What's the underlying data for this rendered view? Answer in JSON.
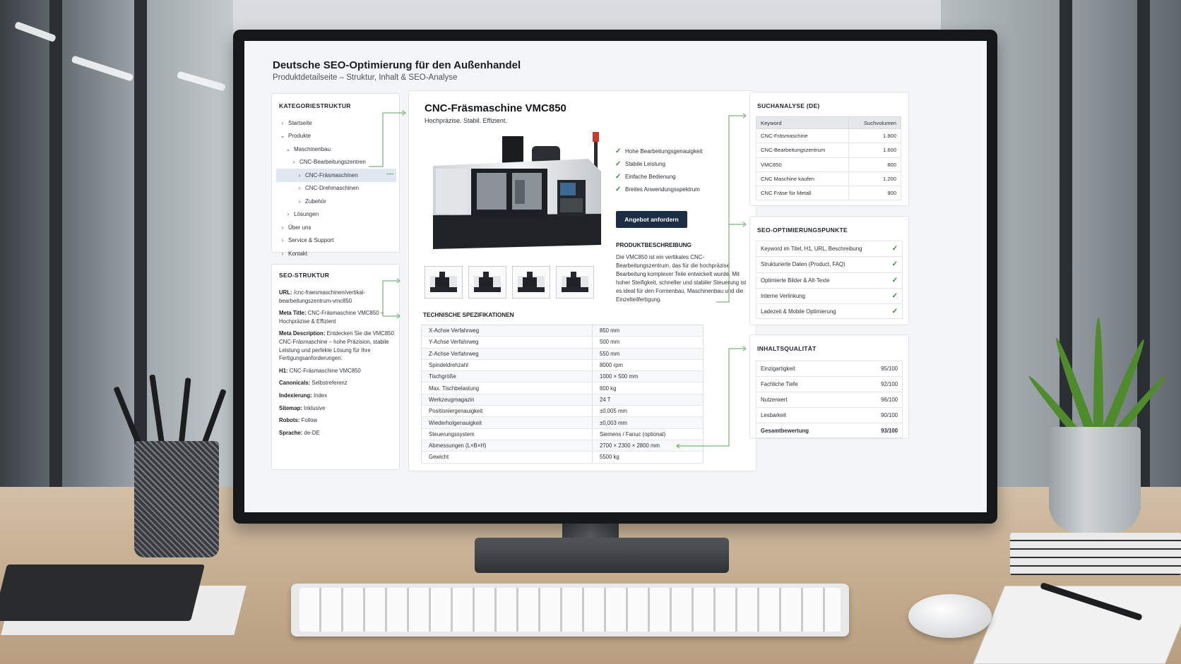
{
  "page": {
    "title": "Deutsche SEO-Optimierung für den Außenhandel",
    "subtitle": "Produktdetailseite – Struktur, Inhalt & SEO-Analyse"
  },
  "categories": {
    "heading": "KATEGORIESTRUKTUR",
    "items": [
      {
        "label": "Startseite",
        "depth": 0,
        "chevron": "›",
        "selected": false
      },
      {
        "label": "Produkte",
        "depth": 0,
        "chevron": "⌄",
        "selected": false
      },
      {
        "label": "Maschinenbau",
        "depth": 1,
        "chevron": "⌄",
        "selected": false
      },
      {
        "label": "CNC-Bearbeitungszentren",
        "depth": 2,
        "chevron": "›",
        "selected": false
      },
      {
        "label": "CNC-Fräsmaschinen",
        "depth": 3,
        "chevron": "›",
        "selected": true
      },
      {
        "label": "CNC-Drehmaschinen",
        "depth": 3,
        "chevron": "›",
        "selected": false
      },
      {
        "label": "Zubehör",
        "depth": 3,
        "chevron": "›",
        "selected": false
      },
      {
        "label": "Lösungen",
        "depth": 1,
        "chevron": "›",
        "selected": false
      },
      {
        "label": "Über uns",
        "depth": 0,
        "chevron": "›",
        "selected": false
      },
      {
        "label": "Service & Support",
        "depth": 0,
        "chevron": "›",
        "selected": false
      },
      {
        "label": "Kontakt",
        "depth": 0,
        "chevron": "›",
        "selected": false
      }
    ]
  },
  "seo_structure": {
    "heading": "SEO-STRUKTUR",
    "items": [
      {
        "key": "URL:",
        "value": "/cnc-fraesmaschinen/vertikal-bearbeitungszentrum-vmc850"
      },
      {
        "key": "Meta Title:",
        "value": "CNC-Fräsmaschine VMC850 – Hochpräzise & Effizient"
      },
      {
        "key": "Meta Description:",
        "value": "Entdecken Sie die VMC850 CNC-Fräsmaschine – hohe Präzision, stabile Leistung und perfekte Lösung für Ihre Fertigungsanforderungen."
      },
      {
        "key": "H1:",
        "value": "CNC-Fräsmaschine VMC850"
      },
      {
        "key": "Canonicals:",
        "value": "Selbstreferenz"
      },
      {
        "key": "Indexierung:",
        "value": "Index"
      },
      {
        "key": "Sitemap:",
        "value": "Inklusive"
      },
      {
        "key": "Robots:",
        "value": "Follow"
      },
      {
        "key": "Sprache:",
        "value": "de-DE"
      }
    ]
  },
  "product": {
    "title": "CNC-Fräsmaschine VMC850",
    "subtitle": "Hochpräzise. Stabil. Effizient.",
    "features": [
      "Hohe Bearbeitungsgenauigkeit",
      "Stabile Leistung",
      "Einfache Bedienung",
      "Breites Anwendungsspektrum"
    ],
    "cta_label": "Angebot anfordern",
    "description_heading": "PRODUKTBESCHREIBUNG",
    "description": "Die VMC850 ist ein vertikales CNC-Bearbeitungszentrum, das für die hochpräzise Bearbeitung komplexer Teile entwickelt wurde. Mit hoher Steifigkeit, schneller und stabiler Steuerung ist es ideal für den Formenbau, Maschinenbau und die Einzelteilfertigung.",
    "thumbnail_count": 4,
    "specs_heading": "TECHNISCHE SPEZIFIKATIONEN",
    "specs": [
      [
        "X-Achse Verfahrweg",
        "850 mm"
      ],
      [
        "Y-Achse Verfahrweg",
        "500 mm"
      ],
      [
        "Z-Achse Verfahrweg",
        "550 mm"
      ],
      [
        "Spindeldrehzahl",
        "8000 rpm"
      ],
      [
        "Tischgröße",
        "1000 × 500 mm"
      ],
      [
        "Max. Tischbelastung",
        "600 kg"
      ],
      [
        "Werkzeugmagazin",
        "24 T"
      ],
      [
        "Positioniergenauigkeit",
        "±0,005 mm"
      ],
      [
        "Wiederholgenauigkeit",
        "±0,003 mm"
      ],
      [
        "Steuerungssystem",
        "Siemens / Fanuc (optional)"
      ],
      [
        "Abmessungen (L×B×H)",
        "2700 × 2300 × 2800 mm"
      ],
      [
        "Gewicht",
        "5500 kg"
      ]
    ]
  },
  "search_analysis": {
    "heading": "SUCHANALYSE (DE)",
    "columns": [
      "Keyword",
      "Suchvolumen"
    ],
    "rows": [
      [
        "CNC-Fräsmaschine",
        "1.900"
      ],
      [
        "CNC-Bearbeitungszentrum",
        "1.600"
      ],
      [
        "VMC850",
        "800"
      ],
      [
        "CNC Maschine kaufen",
        "1.200"
      ],
      [
        "CNC Fräse für Metall",
        "900"
      ]
    ]
  },
  "seo_points": {
    "heading": "SEO-OPTIMIERUNGSPUNKTE",
    "items": [
      "Keyword im Titel, H1, URL, Beschreibung",
      "Strukturierte Daten (Product, FAQ)",
      "Optimierte Bilder & Alt-Texte",
      "Interne Verlinkung",
      "Ladezeit & Mobile Optimierung"
    ],
    "check_icon": "✓"
  },
  "content_quality": {
    "heading": "INHALTSQUALITÄT",
    "rows": [
      [
        "Einzigartigkeit",
        "95/100"
      ],
      [
        "Fachliche Tiefe",
        "92/100"
      ],
      [
        "Nutzerwert",
        "96/100"
      ],
      [
        "Lesbarkeit",
        "90/100"
      ],
      [
        "Gesamtbewertung",
        "93/100"
      ]
    ]
  },
  "colors": {
    "accent_dark": "#1c2e44",
    "check_green": "#2f8a3a",
    "connector_green": "#5ea35a"
  }
}
